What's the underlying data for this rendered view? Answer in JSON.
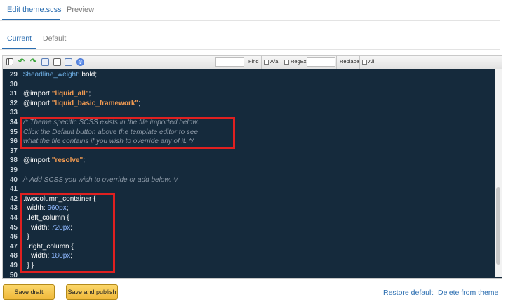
{
  "tabs": [
    {
      "label": "Edit theme.scss",
      "active": true
    },
    {
      "label": "Preview",
      "active": false
    }
  ],
  "subtabs": [
    {
      "label": "Current",
      "active": true
    },
    {
      "label": "Default",
      "active": false
    }
  ],
  "toolbar": {
    "icons": [
      "trash-icon",
      "undo-icon",
      "redo-icon",
      "page-icon",
      "document-icon",
      "page-icon",
      "help-icon"
    ],
    "find_label": "Find",
    "case_label": "A/a",
    "regex_label": "RegEx",
    "replace_label": "Replace",
    "all_label": "All"
  },
  "code": {
    "line_numbers": [
      "29",
      "30",
      "31",
      "32",
      "33",
      "34",
      "35",
      "36",
      "37",
      "38",
      "39",
      "40",
      "41",
      "42",
      "43",
      "44",
      "45",
      "46",
      "47",
      "48",
      "49",
      "50"
    ],
    "lines": [
      {
        "num": "29",
        "tokens": [
          {
            "t": "$headline_weight",
            "c": "var"
          },
          {
            "t": ": bold;",
            "c": "kw"
          }
        ]
      },
      {
        "num": "30",
        "tokens": []
      },
      {
        "num": "31",
        "tokens": [
          {
            "t": "@import ",
            "c": "kw"
          },
          {
            "t": "\"liquid_all\"",
            "c": "str"
          },
          {
            "t": ";",
            "c": "kw"
          }
        ]
      },
      {
        "num": "32",
        "tokens": [
          {
            "t": "@import ",
            "c": "kw"
          },
          {
            "t": "\"liquid_basic_framework\"",
            "c": "str"
          },
          {
            "t": ";",
            "c": "kw"
          }
        ]
      },
      {
        "num": "33",
        "tokens": []
      },
      {
        "num": "34",
        "tokens": [
          {
            "t": "/* Theme specific SCSS exists in the file imported below.",
            "c": "com"
          }
        ]
      },
      {
        "num": "35",
        "tokens": [
          {
            "t": "Click the Default button above the template editor to see",
            "c": "com"
          }
        ]
      },
      {
        "num": "36",
        "tokens": [
          {
            "t": "what the file contains if you wish to override any of it. */",
            "c": "com"
          }
        ]
      },
      {
        "num": "37",
        "tokens": []
      },
      {
        "num": "38",
        "tokens": [
          {
            "t": "@import ",
            "c": "kw"
          },
          {
            "t": "\"resolve\"",
            "c": "str"
          },
          {
            "t": ";",
            "c": "kw"
          }
        ]
      },
      {
        "num": "39",
        "tokens": []
      },
      {
        "num": "40",
        "tokens": [
          {
            "t": "/* Add SCSS you wish to override or add below. */",
            "c": "com"
          }
        ]
      },
      {
        "num": "41",
        "tokens": []
      },
      {
        "num": "42",
        "tokens": [
          {
            "t": ".twocolumn_container {",
            "c": "sel"
          }
        ]
      },
      {
        "num": "43",
        "tokens": [
          {
            "t": "  width: ",
            "c": "kw"
          },
          {
            "t": "960px",
            "c": "num"
          },
          {
            "t": ";",
            "c": "kw"
          }
        ]
      },
      {
        "num": "44",
        "tokens": [
          {
            "t": "  .left_column {",
            "c": "sel"
          }
        ]
      },
      {
        "num": "45",
        "tokens": [
          {
            "t": "    width: ",
            "c": "kw"
          },
          {
            "t": "720px",
            "c": "num"
          },
          {
            "t": ";",
            "c": "kw"
          }
        ]
      },
      {
        "num": "46",
        "tokens": [
          {
            "t": "  }",
            "c": "kw"
          }
        ]
      },
      {
        "num": "47",
        "tokens": [
          {
            "t": "  .right_column {",
            "c": "sel"
          }
        ]
      },
      {
        "num": "48",
        "tokens": [
          {
            "t": "    width: ",
            "c": "kw"
          },
          {
            "t": "180px",
            "c": "num"
          },
          {
            "t": ";",
            "c": "kw"
          }
        ]
      },
      {
        "num": "49",
        "tokens": [
          {
            "t": "  } }",
            "c": "kw"
          }
        ]
      },
      {
        "num": "50",
        "tokens": []
      }
    ]
  },
  "buttons": {
    "save_draft": "Save draft",
    "save_publish": "Save and publish",
    "restore_default": "Restore default",
    "delete_from_theme": "Delete from theme"
  },
  "colors": {
    "accent": "#2a6db0",
    "editor_bg": "#152a3c",
    "highlight": "#e02020",
    "button": "#f0b93b"
  }
}
